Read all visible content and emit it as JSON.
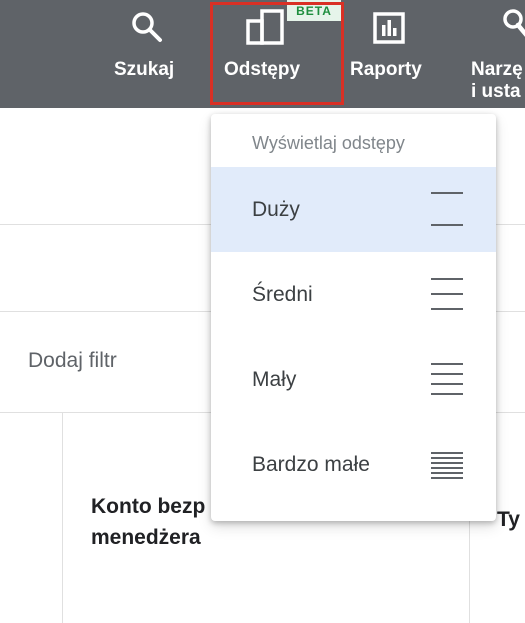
{
  "toolbar": {
    "search_label": "Szukaj",
    "spacing_label": "Odstępy",
    "spacing_badge": "BETA",
    "reports_label": "Raporty",
    "tools_label_line1": "Narzę",
    "tools_label_line2": "i usta"
  },
  "filter": {
    "add_filter_label": "Dodaj filtr"
  },
  "table": {
    "column_1_line1": "Konto bezp",
    "column_1_line2": "menedżera",
    "column_2_fragment": "Ty"
  },
  "spacing_menu": {
    "heading": "Wyświetlaj odstępy",
    "items": [
      {
        "label": "Duży",
        "icon": "density-large-icon",
        "lines": 2,
        "selected": true
      },
      {
        "label": "Średni",
        "icon": "density-medium-icon",
        "lines": 3,
        "selected": false
      },
      {
        "label": "Mały",
        "icon": "density-small-icon",
        "lines": 4,
        "selected": false
      },
      {
        "label": "Bardzo małe",
        "icon": "density-extra-small-icon",
        "lines": 6,
        "selected": false
      }
    ]
  },
  "colors": {
    "toolbar_bg": "#5f6368",
    "highlight_border": "#d93025",
    "selected_item_bg": "#e1ebfa",
    "beta_text": "#1e8e3e"
  }
}
